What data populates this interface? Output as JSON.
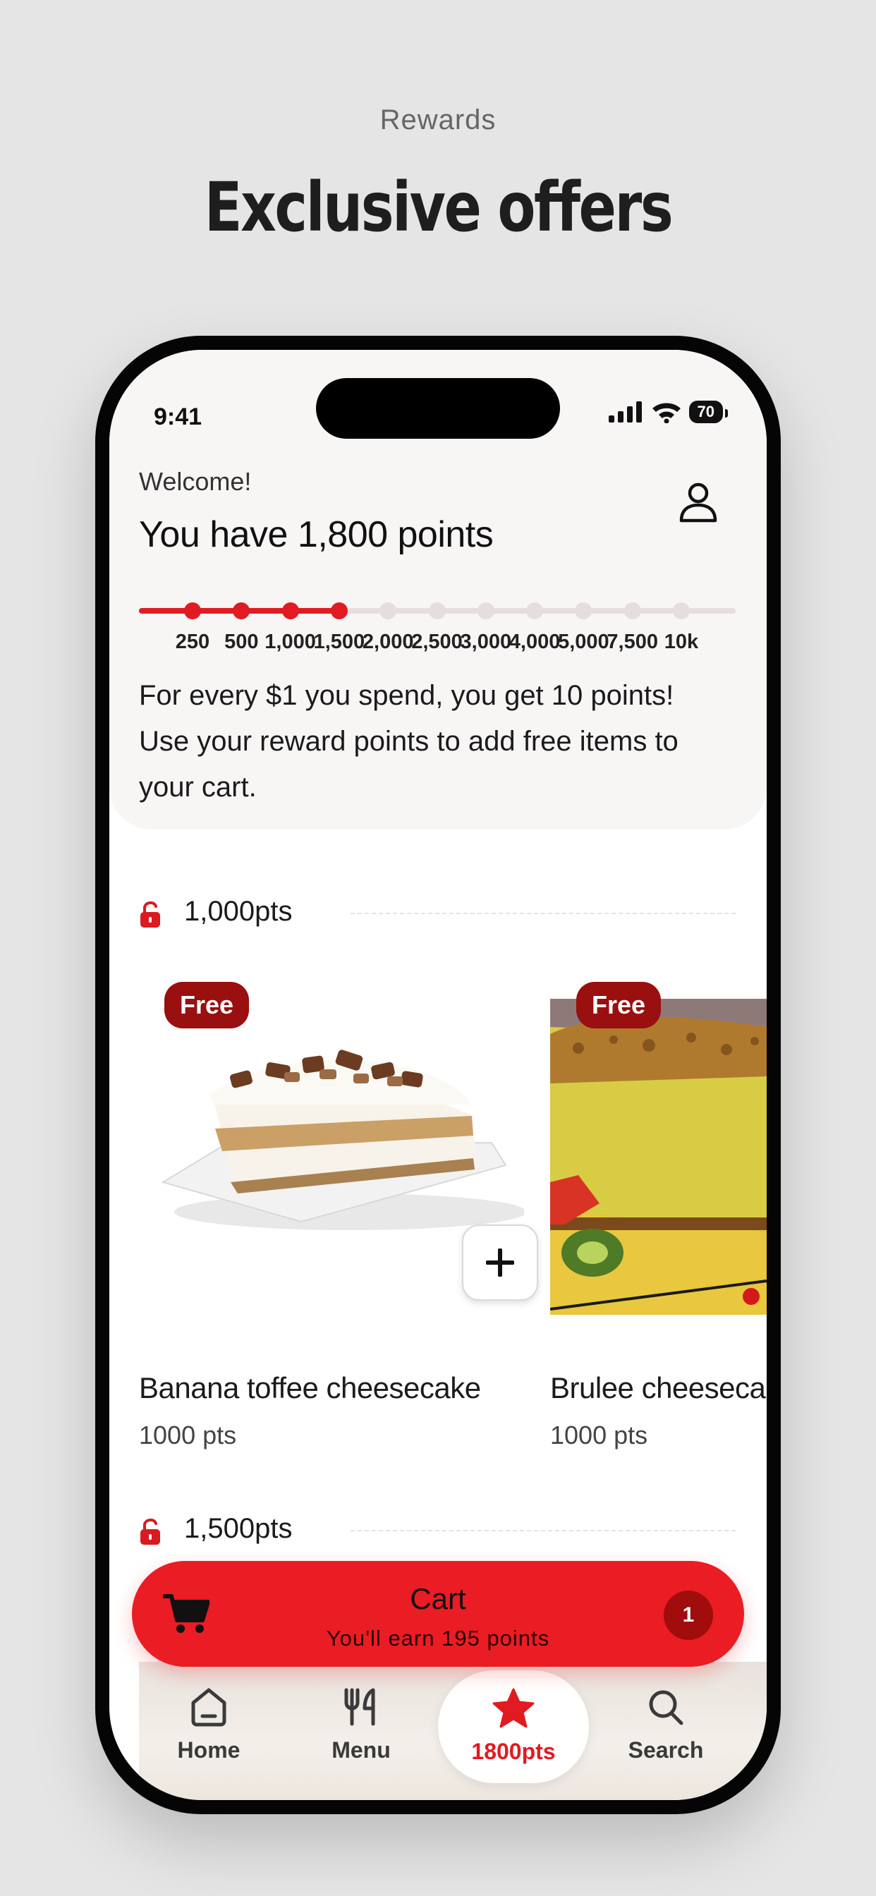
{
  "caption": {
    "eyebrow": "Rewards",
    "title": "Exclusive offers"
  },
  "status_bar": {
    "time": "9:41",
    "battery": "70"
  },
  "header": {
    "welcome": "Welcome!",
    "points_title": "You have 1,800 points",
    "progress": {
      "ticks": [
        "250",
        "500",
        "1,000",
        "1,500",
        "2,000",
        "2,500",
        "3,000",
        "4,000",
        "5,000",
        "7,500",
        "10k"
      ],
      "current_points": 1800,
      "reached_tick_count": 4
    },
    "info": "For every $1 you spend, you get 10 points! Use your reward points to add free items to your cart."
  },
  "tiers": [
    {
      "label": "1,000pts",
      "items": [
        {
          "badge": "Free",
          "name": "Banana toffee cheesecake",
          "points": "1000 pts"
        },
        {
          "badge": "Free",
          "name": "Brulee cheeseca",
          "points": "1000 pts"
        }
      ]
    },
    {
      "label": "1,500pts"
    }
  ],
  "cart": {
    "title": "Cart",
    "subtitle": "You'll earn 195 points",
    "count": "1"
  },
  "nav": [
    {
      "label": "Home",
      "icon": "home-icon"
    },
    {
      "label": "Menu",
      "icon": "utensils-icon"
    },
    {
      "label": "1800pts",
      "icon": "star-icon",
      "active": true
    },
    {
      "label": "Search",
      "icon": "search-icon"
    }
  ],
  "colors": {
    "accent": "#e11b22",
    "badge": "#9a0f0f",
    "header_bg": "#f8f5f5",
    "page_bg": "#e5e5e5"
  }
}
